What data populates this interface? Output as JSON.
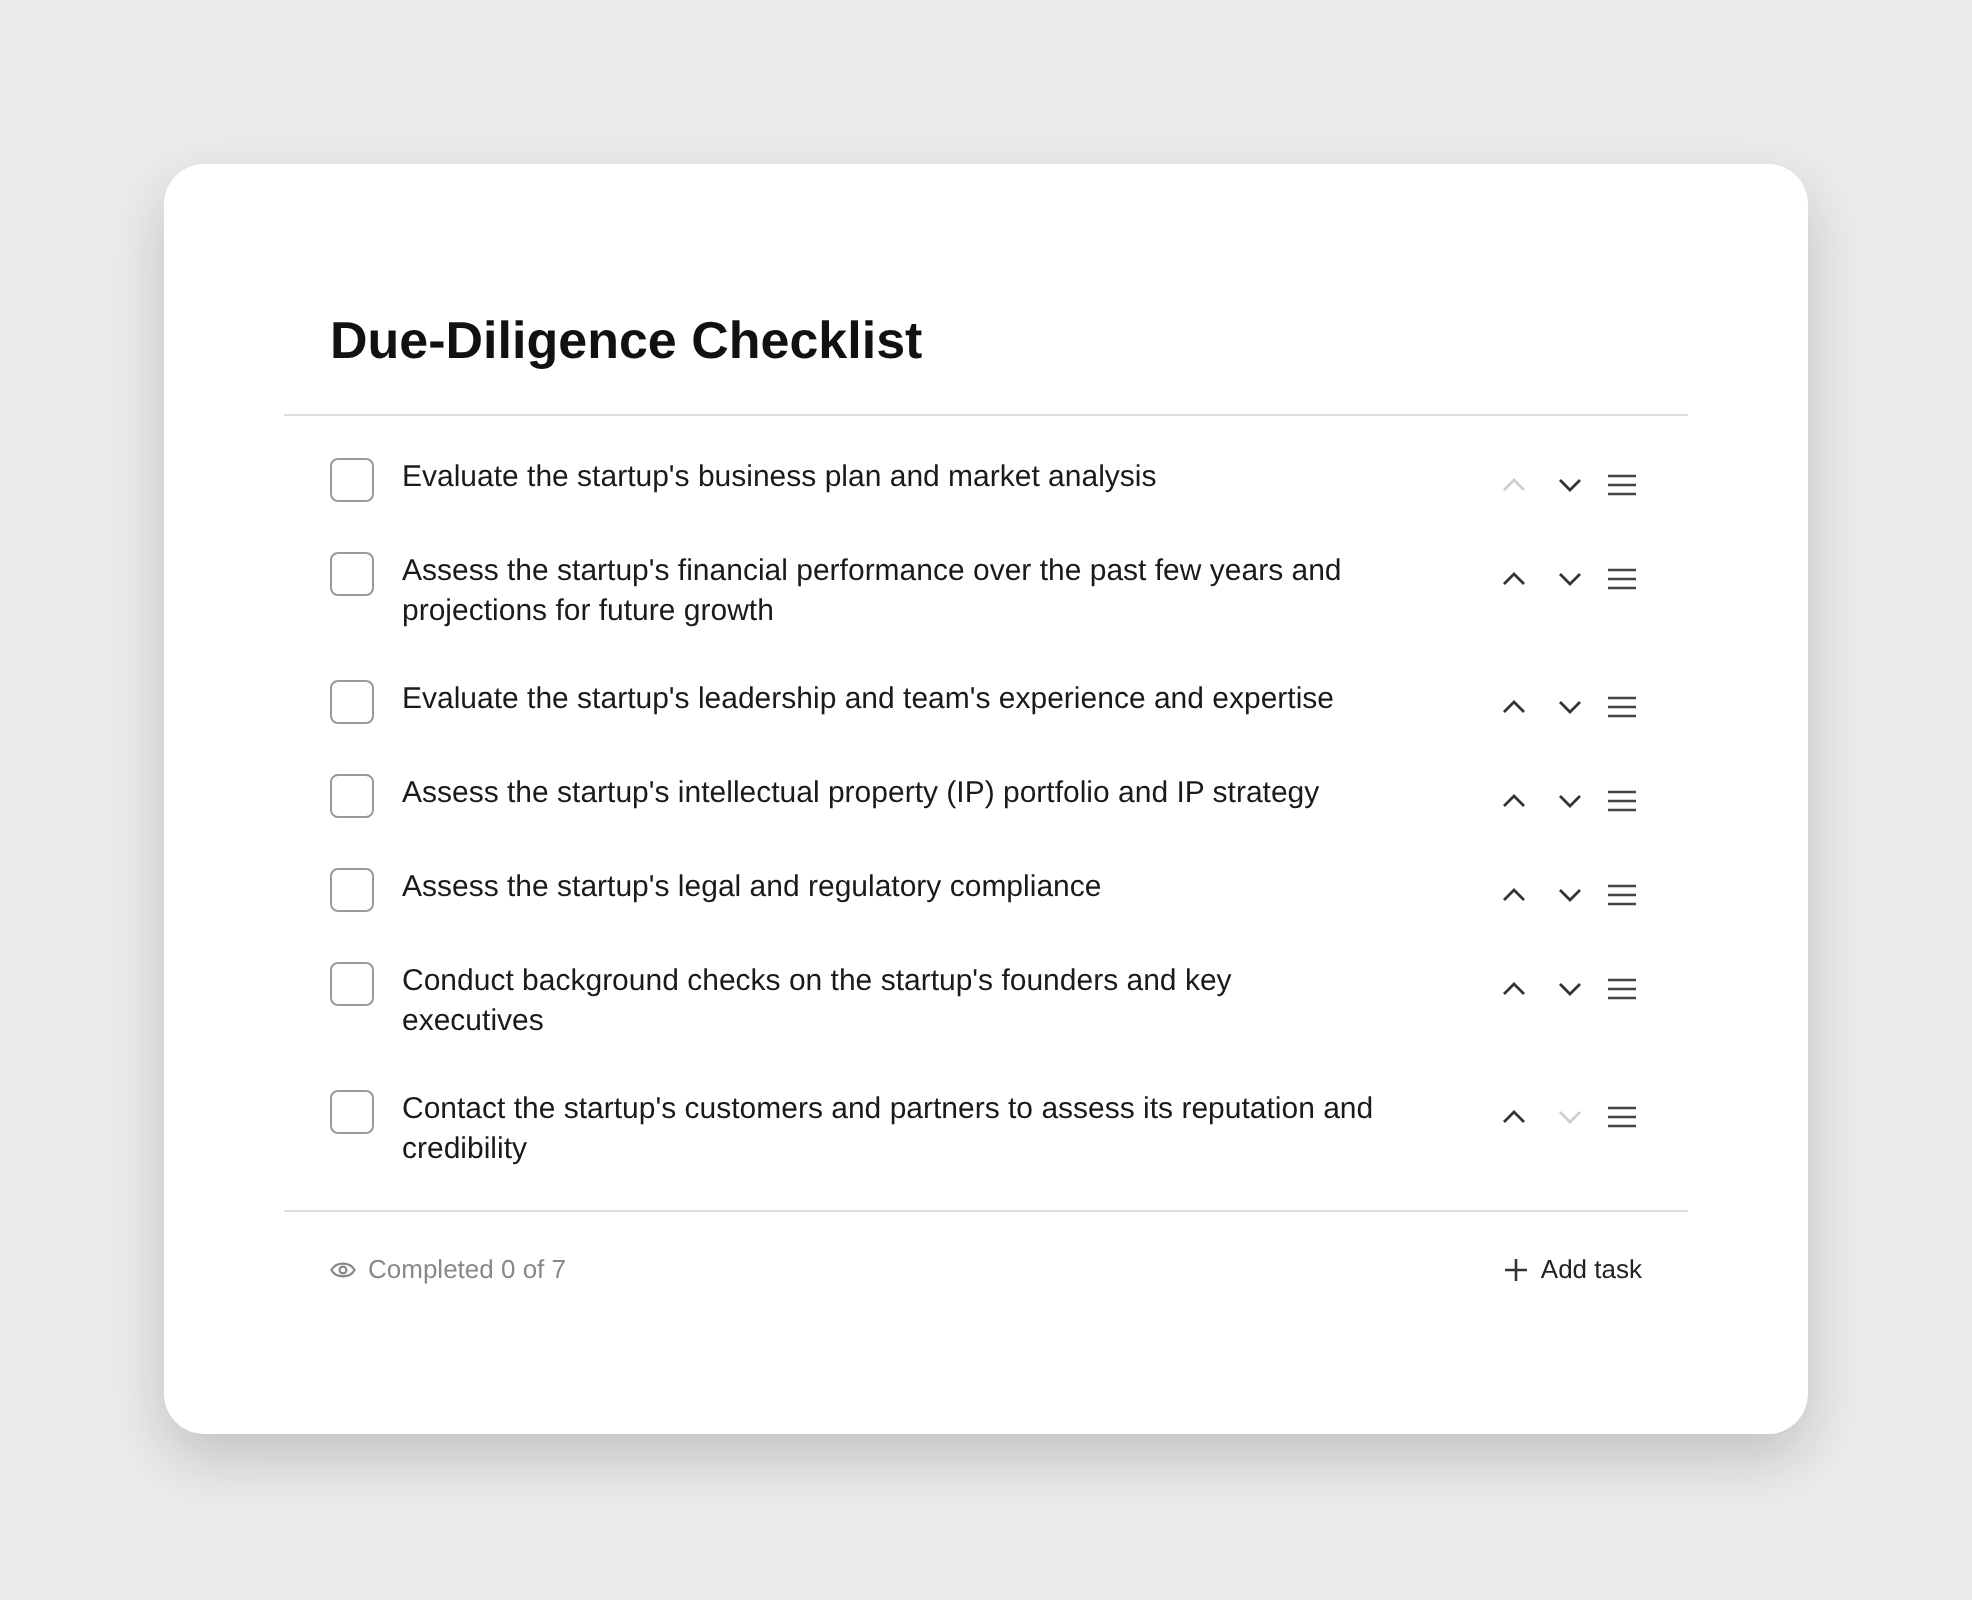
{
  "title": "Due-Diligence Checklist",
  "tasks": [
    {
      "text": "Evaluate the startup's business plan and market analysis",
      "checked": false,
      "up_disabled": true,
      "down_disabled": false
    },
    {
      "text": "Assess the startup's financial performance over the past few years and projections for future growth",
      "checked": false,
      "up_disabled": false,
      "down_disabled": false
    },
    {
      "text": "Evaluate the startup's leadership and team's experience and expertise",
      "checked": false,
      "up_disabled": false,
      "down_disabled": false
    },
    {
      "text": "Assess the startup's intellectual property (IP) portfolio and IP strategy",
      "checked": false,
      "up_disabled": false,
      "down_disabled": false
    },
    {
      "text": "Assess the startup's legal and regulatory compliance",
      "checked": false,
      "up_disabled": false,
      "down_disabled": false
    },
    {
      "text": "Conduct background checks on the startup's founders and key executives",
      "checked": false,
      "up_disabled": false,
      "down_disabled": false
    },
    {
      "text": "Contact the startup's customers and partners to assess its reputation and credibility",
      "checked": false,
      "up_disabled": false,
      "down_disabled": true
    }
  ],
  "footer": {
    "status": "Completed 0 of 7",
    "add_button": "Add task"
  }
}
